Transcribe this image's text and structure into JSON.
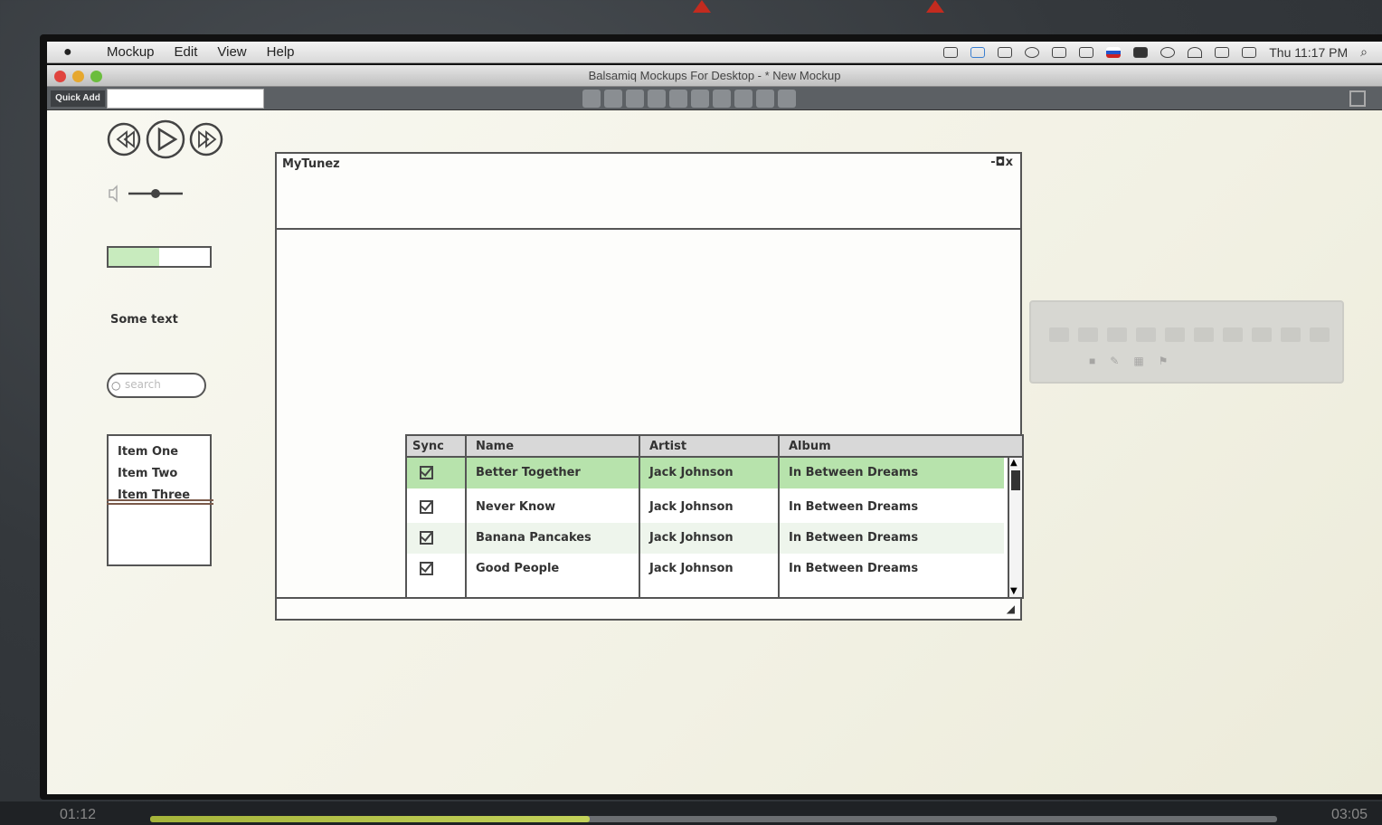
{
  "menubar": {
    "apple": "",
    "menus": [
      "Mockup",
      "Edit",
      "View",
      "Help"
    ],
    "clock": "Thu 11:17 PM"
  },
  "titlebar": {
    "title": "Balsamiq Mockups For Desktop - * New Mockup"
  },
  "toolbar": {
    "quick_add_label": "Quick Add",
    "quick_add_value": ""
  },
  "library": {
    "media_controls": [
      "rewind-icon",
      "play-icon",
      "fast-forward-icon"
    ],
    "volume_level": 0.5,
    "progress_level": 0.5,
    "label_text": "Some text",
    "search_placeholder": "search",
    "list_items": [
      "Item One",
      "Item Two",
      "Item Three"
    ]
  },
  "mockup_window": {
    "title": "MyTunez",
    "controls": "-◘x",
    "grid": {
      "headers": [
        "Sync",
        "Name",
        "Artist",
        "Album"
      ],
      "rows": [
        {
          "sync": true,
          "name": "Better Together",
          "artist": "Jack Johnson",
          "album": "In Between Dreams",
          "selected": true
        },
        {
          "sync": true,
          "name": "Never Know",
          "artist": "Jack Johnson",
          "album": "In Between Dreams",
          "selected": false
        },
        {
          "sync": true,
          "name": "Banana Pancakes",
          "artist": "Jack Johnson",
          "album": "In Between Dreams",
          "selected": false
        },
        {
          "sync": true,
          "name": "Good People",
          "artist": "Jack Johnson",
          "album": "In Between Dreams",
          "selected": false
        }
      ]
    }
  },
  "player": {
    "current_time": "01:12",
    "total_time": "03:05",
    "progress": 0.39
  },
  "colors": {
    "selected_row": "#b7e3ac",
    "alt_row": "#eef5ec",
    "progress_fill": "#b5c44a",
    "marker": "#c32b1f"
  }
}
